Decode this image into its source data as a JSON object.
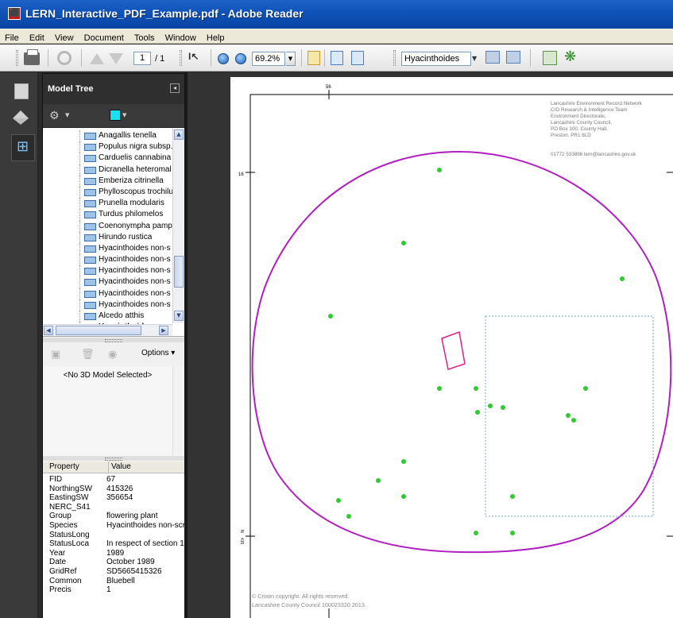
{
  "window": {
    "title": "LERN_Interactive_PDF_Example.pdf - Adobe Reader",
    "app_icon": "adobe-reader-icon"
  },
  "menu": [
    "File",
    "Edit",
    "View",
    "Document",
    "Tools",
    "Window",
    "Help"
  ],
  "toolbar": {
    "page_current": "1",
    "page_total": "/ 1",
    "zoom": "69.2%",
    "search_value": "Hyacinthoides",
    "icons": [
      "print-icon",
      "sync-icon",
      "previous-page-icon",
      "next-page-icon",
      "select-tool-icon",
      "zoom-out-icon",
      "zoom-in-icon",
      "page-view-icon",
      "fit-width-icon",
      "fit-page-icon",
      "find-previous-icon",
      "find-next-icon",
      "object-data-icon",
      "model-tree-icon"
    ]
  },
  "panel": {
    "title": "Model Tree",
    "swatch_color": "#19e0f0",
    "tree_items": [
      "Anagallis tenella",
      "Populus nigra subsp.",
      "Carduelis cannabina",
      "Dicranella heteromal",
      "Emberiza citrinella",
      "Phylloscopus trochilu",
      "Prunella modularis",
      "Turdus philomelos",
      "Coenonympha pamp",
      "Hirundo rustica",
      "Hyacinthoides non-s",
      "Hyacinthoides non-s",
      "Hyacinthoides non-s",
      "Hyacinthoides non-s",
      "Hyacinthoides non-s",
      "Hyacinthoides non-s",
      "Alcedo atthis",
      "Hyacinthoides no"
    ],
    "selected_index": 17,
    "options_label": "Options",
    "no_model_text": "<No 3D Model Selected>",
    "props_header": {
      "property": "Property",
      "value": "Value"
    },
    "properties": [
      {
        "k": "FID",
        "v": "67"
      },
      {
        "k": "NorthingSW",
        "v": "415326"
      },
      {
        "k": "EastingSW",
        "v": "356654"
      },
      {
        "k": "NERC_S41",
        "v": ""
      },
      {
        "k": "Group",
        "v": "flowering plant"
      },
      {
        "k": "Species",
        "v": "Hyacinthoides non-scr"
      },
      {
        "k": "StatusLong",
        "v": ""
      },
      {
        "k": "StatusLoca",
        "v": "In respect of section 1"
      },
      {
        "k": "Year",
        "v": "1989"
      },
      {
        "k": "Date",
        "v": "October 1989"
      },
      {
        "k": "GridRef",
        "v": "SD5665415326"
      },
      {
        "k": "Common",
        "v": "Bluebell"
      },
      {
        "k": "Precis",
        "v": "1"
      }
    ]
  },
  "map": {
    "grid_top": "56",
    "grid_left": "16",
    "grid_left_bottom": "N",
    "grid_left_bottom_sub": "415",
    "address_lines": [
      "Lancashire Environment Record Network",
      "C/O Research & Intelligence Team",
      "Environment Directorate,",
      "Lancashire County Council,",
      "PO Box 100, County Hall,",
      "Preston. PR1 8LD"
    ],
    "contact": "01772 533896  lern@lancashire.gov.uk",
    "copyright1": "© Crown copyright.  All rights reserved.",
    "copyright2": "Lancashire County Council 100023320 2013.",
    "circle_color": "#b020c0",
    "point_color": "#2ecc2e",
    "polygon_color": "#e0208a",
    "box_color": "#7aa7d4"
  }
}
